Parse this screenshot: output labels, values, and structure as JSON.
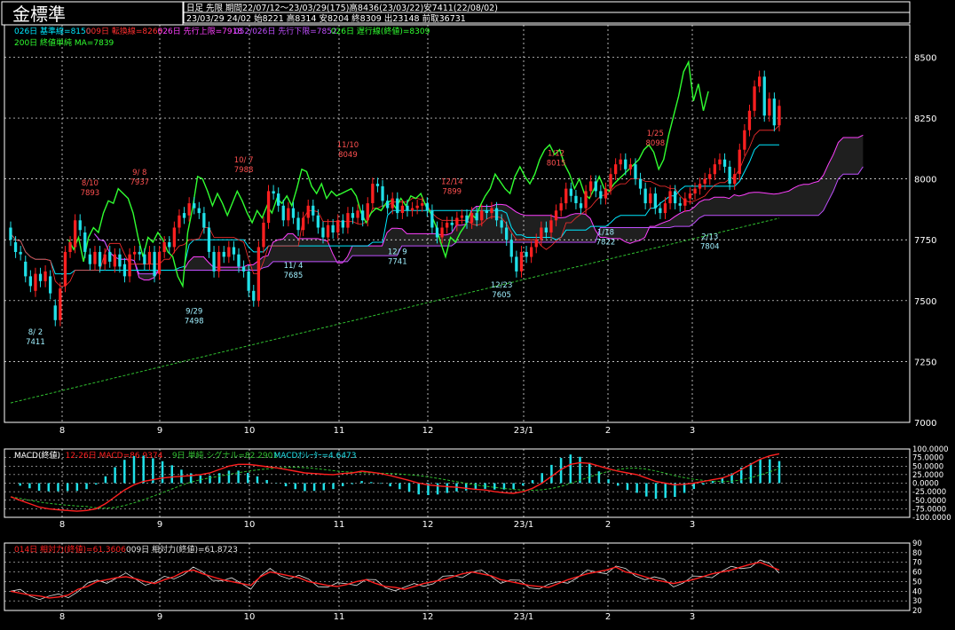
{
  "header": {
    "title": "金標準",
    "info_line1": "日足  先限  期間22/07/12～23/03/29(175)高8436(23/03/22)安7411(22/08/02)",
    "info_line2": "23/03/29 24/02 始8221 高8314 安8204 終8309 出23148 前取36731"
  },
  "colors": {
    "background": "#000000",
    "up_candle": "#ff2020",
    "down_candle": "#20e0e8",
    "kijun": "#00e8ff",
    "tenkan": "#ff3030",
    "cloud_upper": "#ff40ff",
    "cloud_lower": "#c050ff",
    "chikou": "#30ff30",
    "ma200": "#30c030",
    "macd": "#ff2020",
    "signal": "#30c030",
    "osc": "#20e0e8",
    "rsi14": "#ff2020",
    "rsi9": "#e0e0e0",
    "grid": "#ffffff"
  },
  "chart_data": [
    {
      "type": "candlestick",
      "panel": "price",
      "legend": [
        {
          "text": "026日 基準線=8150",
          "color": "#00e8ff"
        },
        {
          "text": "009日 転換線=8265",
          "color": "#ff3030"
        },
        {
          "text": "026日 先行上限=7918",
          "color": "#ff40ff"
        },
        {
          "text": "052/026日 先行下限=7852",
          "color": "#c050ff"
        },
        {
          "text": "026日 遅行線(終値)=8309",
          "color": "#30ff30"
        },
        {
          "text": "200日 終値単純 MA=7839",
          "color": "#30ff30"
        }
      ],
      "x_tick_labels": [
        "8",
        "9",
        "10",
        "11",
        "12",
        "23/1",
        "2",
        "3"
      ],
      "y_ticks": [
        7000,
        7250,
        7500,
        7750,
        8000,
        8250,
        8500
      ],
      "ylim": [
        7000,
        8560
      ],
      "annotations": [
        {
          "date": "8/ 2",
          "value": 7411,
          "kind": "low"
        },
        {
          "date": "8/10",
          "value": 7893,
          "kind": "high"
        },
        {
          "date": "9/ 8",
          "value": 7937,
          "kind": "high"
        },
        {
          "date": "9/29",
          "value": 7498,
          "kind": "low"
        },
        {
          "date": "10/ 7",
          "value": 7988,
          "kind": "high"
        },
        {
          "date": "11/ 4",
          "value": 7685,
          "kind": "low"
        },
        {
          "date": "11/10",
          "value": 8049,
          "kind": "high"
        },
        {
          "date": "12/ 9",
          "value": 7741,
          "kind": "low"
        },
        {
          "date": "12/14",
          "value": 7899,
          "kind": "high"
        },
        {
          "date": "12/23",
          "value": 7605,
          "kind": "low"
        },
        {
          "date": "1/12",
          "value": 8015,
          "kind": "high"
        },
        {
          "date": "1/18",
          "value": 7822,
          "kind": "low"
        },
        {
          "date": "1/25",
          "value": 8098,
          "kind": "high"
        },
        {
          "date": "2/13",
          "value": 7804,
          "kind": "low"
        }
      ],
      "close_series_approx": [
        [
          7800,
          7750
        ],
        [
          7740,
          7700
        ],
        [
          7700,
          7690
        ],
        [
          7660,
          7600
        ],
        [
          7600,
          7560
        ],
        [
          7540,
          7610
        ],
        [
          7610,
          7580
        ],
        [
          7580,
          7620
        ],
        [
          7600,
          7530
        ],
        [
          7480,
          7420
        ],
        [
          7420,
          7550
        ],
        [
          7560,
          7700
        ],
        [
          7700,
          7740
        ],
        [
          7720,
          7830
        ],
        [
          7830,
          7790
        ],
        [
          7780,
          7700
        ],
        [
          7690,
          7650
        ],
        [
          7650,
          7700
        ],
        [
          7700,
          7640
        ],
        [
          7650,
          7690
        ],
        [
          7700,
          7660
        ],
        [
          7640,
          7690
        ],
        [
          7690,
          7640
        ],
        [
          7650,
          7600
        ],
        [
          7600,
          7690
        ],
        [
          7690,
          7700
        ],
        [
          7700,
          7690
        ],
        [
          7690,
          7650
        ],
        [
          7650,
          7700
        ],
        [
          7700,
          7600
        ],
        [
          7610,
          7700
        ],
        [
          7700,
          7740
        ],
        [
          7740,
          7720
        ],
        [
          7720,
          7800
        ],
        [
          7800,
          7850
        ],
        [
          7860,
          7840
        ],
        [
          7850,
          7900
        ],
        [
          7900,
          7880
        ],
        [
          7880,
          7860
        ],
        [
          7860,
          7800
        ],
        [
          7800,
          7700
        ],
        [
          7700,
          7620
        ],
        [
          7620,
          7700
        ],
        [
          7700,
          7680
        ],
        [
          7680,
          7720
        ],
        [
          7720,
          7690
        ],
        [
          7690,
          7640
        ],
        [
          7640,
          7620
        ],
        [
          7620,
          7540
        ],
        [
          7540,
          7500
        ],
        [
          7500,
          7720
        ],
        [
          7720,
          7820
        ],
        [
          7820,
          7950
        ],
        [
          7950,
          7940
        ],
        [
          7940,
          7890
        ],
        [
          7890,
          7830
        ],
        [
          7830,
          7880
        ],
        [
          7880,
          7840
        ],
        [
          7840,
          7790
        ],
        [
          7790,
          7840
        ],
        [
          7840,
          7890
        ],
        [
          7890,
          7850
        ],
        [
          7850,
          7800
        ],
        [
          7800,
          7760
        ],
        [
          7760,
          7810
        ],
        [
          7810,
          7780
        ],
        [
          7780,
          7830
        ],
        [
          7830,
          7800
        ],
        [
          7800,
          7860
        ],
        [
          7860,
          7840
        ],
        [
          7840,
          7870
        ],
        [
          7870,
          7830
        ],
        [
          7830,
          7900
        ],
        [
          7900,
          7980
        ],
        [
          7980,
          7970
        ],
        [
          7970,
          7910
        ],
        [
          7910,
          7880
        ],
        [
          7880,
          7920
        ],
        [
          7920,
          7860
        ],
        [
          7860,
          7890
        ],
        [
          7890,
          7870
        ],
        [
          7870,
          7880
        ],
        [
          7880,
          7890
        ],
        [
          7890,
          7900
        ],
        [
          7900,
          7870
        ],
        [
          7870,
          7800
        ],
        [
          7800,
          7760
        ],
        [
          7760,
          7800
        ],
        [
          7800,
          7820
        ],
        [
          7820,
          7810
        ],
        [
          7810,
          7840
        ],
        [
          7840,
          7850
        ],
        [
          7850,
          7820
        ],
        [
          7820,
          7860
        ],
        [
          7860,
          7830
        ],
        [
          7830,
          7870
        ],
        [
          7870,
          7860
        ],
        [
          7860,
          7880
        ],
        [
          7880,
          7830
        ],
        [
          7830,
          7800
        ],
        [
          7800,
          7750
        ],
        [
          7750,
          7680
        ],
        [
          7680,
          7620
        ],
        [
          7620,
          7700
        ],
        [
          7700,
          7680
        ],
        [
          7680,
          7720
        ],
        [
          7720,
          7750
        ],
        [
          7750,
          7800
        ],
        [
          7800,
          7780
        ],
        [
          7780,
          7830
        ],
        [
          7830,
          7870
        ],
        [
          7870,
          7900
        ],
        [
          7900,
          7960
        ],
        [
          7960,
          7930
        ],
        [
          7930,
          7900
        ],
        [
          7900,
          7880
        ],
        [
          7880,
          7950
        ],
        [
          7950,
          7990
        ],
        [
          7990,
          7950
        ],
        [
          7950,
          7920
        ],
        [
          7920,
          7960
        ],
        [
          7960,
          8020
        ],
        [
          8020,
          8060
        ],
        [
          8060,
          8080
        ],
        [
          8080,
          8040
        ],
        [
          8040,
          8060
        ],
        [
          8060,
          8000
        ],
        [
          8000,
          7960
        ],
        [
          7960,
          7900
        ],
        [
          7900,
          7940
        ],
        [
          7940,
          7880
        ],
        [
          7880,
          7860
        ],
        [
          7860,
          7900
        ],
        [
          7900,
          7950
        ],
        [
          7950,
          7900
        ],
        [
          7900,
          7890
        ],
        [
          7890,
          7920
        ],
        [
          7920,
          7940
        ],
        [
          7940,
          7960
        ],
        [
          7960,
          7980
        ],
        [
          7980,
          8000
        ],
        [
          8000,
          8020
        ],
        [
          8020,
          8060
        ],
        [
          8060,
          8080
        ],
        [
          8080,
          8050
        ],
        [
          8050,
          7980
        ],
        [
          7980,
          8020
        ],
        [
          8020,
          8120
        ],
        [
          8120,
          8200
        ],
        [
          8200,
          8280
        ],
        [
          8280,
          8380
        ],
        [
          8380,
          8420
        ],
        [
          8420,
          8260
        ],
        [
          8260,
          8330
        ],
        [
          8330,
          8220
        ],
        [
          8220,
          8300
        ]
      ]
    },
    {
      "type": "line",
      "panel": "macd",
      "legend": [
        {
          "text": "MACD(終値)",
          "color": "#ffffff"
        },
        {
          "text": "12-26日 MACD=86.9374",
          "color": "#ff2020"
        },
        {
          "text": "9日 単純 シグナル=82.2901",
          "color": "#30c030"
        },
        {
          "text": "MACDｵｼﾚｰﾀｰ=4.6473",
          "color": "#20e0e8"
        }
      ],
      "y_tick_labels": [
        "100.0000",
        "75.0000",
        "50.0000",
        "25.0000",
        "0.0000",
        "-25.0000",
        "-50.0000",
        "-75.0000",
        "-100.0000"
      ],
      "ylim": [
        -100,
        100
      ],
      "macd_approx": [
        -40,
        -50,
        -60,
        -70,
        -75,
        -78,
        -80,
        -82,
        -80,
        -75,
        -60,
        -40,
        -20,
        -5,
        5,
        10,
        15,
        18,
        20,
        22,
        25,
        30,
        40,
        50,
        55,
        55,
        52,
        48,
        45,
        40,
        35,
        30,
        28,
        26,
        25,
        28,
        30,
        35,
        32,
        28,
        22,
        15,
        8,
        0,
        -5,
        -8,
        -10,
        -12,
        -15,
        -18,
        -20,
        -25,
        -28,
        -30,
        -25,
        -15,
        0,
        20,
        40,
        55,
        60,
        58,
        50,
        42,
        35,
        30,
        25,
        15,
        5,
        0,
        -5,
        -3,
        0,
        5,
        10,
        15,
        25,
        40,
        55,
        70,
        80,
        86
      ]
    },
    {
      "type": "line",
      "panel": "rsi",
      "legend": [
        {
          "text": "014日 相対力(終値)=61.3606",
          "color": "#ff2020"
        },
        {
          "text": "009日 相対力(終値)=61.8723",
          "color": "#e0e0e0"
        }
      ],
      "y_tick_labels": [
        "90",
        "80",
        "70",
        "60",
        "50",
        "40",
        "30",
        "20"
      ],
      "ylim": [
        20,
        90
      ],
      "rsi_approx": [
        40,
        38,
        36,
        35,
        33,
        34,
        36,
        42,
        45,
        50,
        52,
        54,
        55,
        53,
        50,
        48,
        52,
        55,
        60,
        62,
        58,
        55,
        52,
        50,
        48,
        46,
        55,
        60,
        58,
        56,
        54,
        50,
        48,
        46,
        45,
        47,
        50,
        52,
        48,
        45,
        44,
        42,
        45,
        48,
        50,
        52,
        55,
        58,
        60,
        58,
        56,
        52,
        50,
        48,
        46,
        45,
        44,
        48,
        52,
        55,
        58,
        60,
        62,
        65,
        60,
        58,
        55,
        52,
        50,
        48,
        50,
        52,
        55,
        58,
        60,
        62,
        65,
        68,
        70,
        66,
        62
      ]
    }
  ]
}
